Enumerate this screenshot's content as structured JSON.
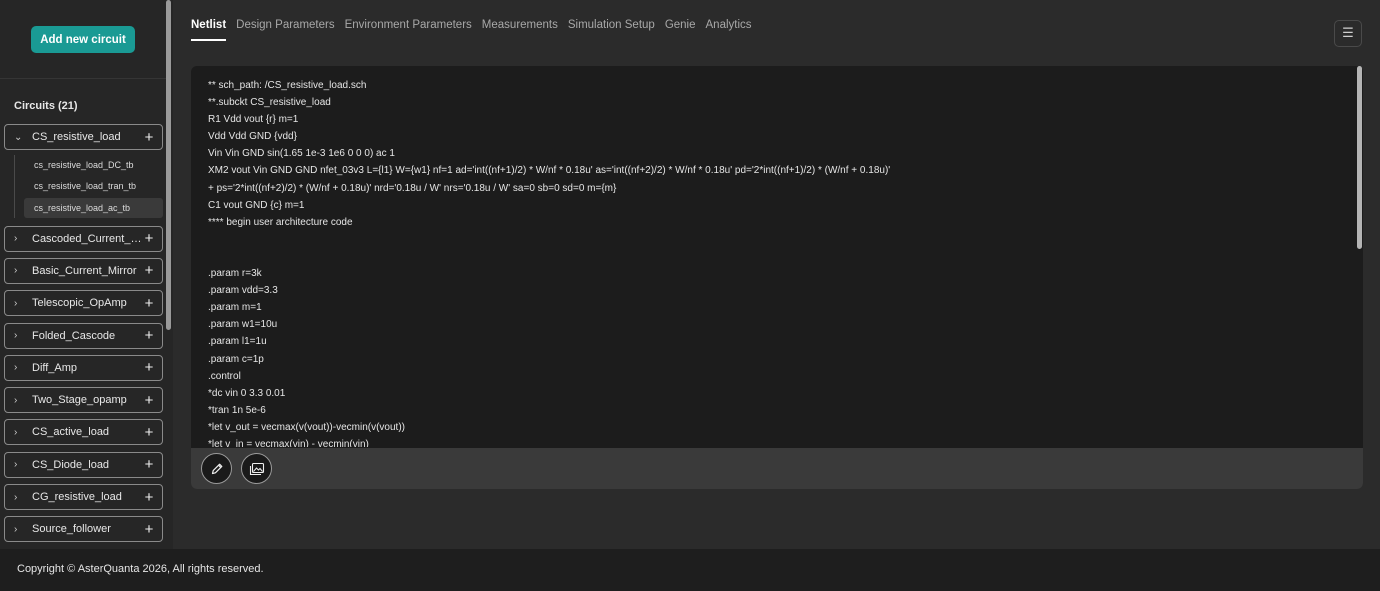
{
  "sidebar": {
    "add_button": "Add new circuit",
    "circuits_title": "Circuits (21)",
    "circuits": [
      {
        "name": "CS_resistive_load",
        "expanded": true,
        "children": [
          "cs_resistive_load_DC_tb",
          "cs_resistive_load_tran_tb",
          "cs_resistive_load_ac_tb"
        ],
        "active_child": 2
      },
      {
        "name": "Cascoded_Current_Mirror",
        "expanded": false
      },
      {
        "name": "Basic_Current_Mirror",
        "expanded": false
      },
      {
        "name": "Telescopic_OpAmp",
        "expanded": false
      },
      {
        "name": "Folded_Cascode",
        "expanded": false
      },
      {
        "name": "Diff_Amp",
        "expanded": false
      },
      {
        "name": "Two_Stage_opamp",
        "expanded": false
      },
      {
        "name": "CS_active_load",
        "expanded": false
      },
      {
        "name": "CS_Diode_load",
        "expanded": false
      },
      {
        "name": "CG_resistive_load",
        "expanded": false
      },
      {
        "name": "Source_follower",
        "expanded": false
      }
    ]
  },
  "tabs": [
    {
      "label": "Netlist",
      "active": true
    },
    {
      "label": "Design Parameters",
      "active": false
    },
    {
      "label": "Environment Parameters",
      "active": false
    },
    {
      "label": "Measurements",
      "active": false
    },
    {
      "label": "Simulation Setup",
      "active": false
    },
    {
      "label": "Genie",
      "active": false
    },
    {
      "label": "Analytics",
      "active": false
    }
  ],
  "menu_icon": "menu-icon",
  "editor": {
    "lines": [
      "** sch_path: /CS_resistive_load.sch",
      "**.subckt CS_resistive_load",
      "R1 Vdd vout {r} m=1",
      "Vdd Vdd GND {vdd}",
      "Vin Vin GND sin(1.65 1e-3 1e6 0 0 0) ac 1",
      "XM2 vout Vin GND GND nfet_03v3 L={l1} W={w1} nf=1 ad='int((nf+1)/2) * W/nf * 0.18u' as='int((nf+2)/2) * W/nf * 0.18u' pd='2*int((nf+1)/2) * (W/nf + 0.18u)'",
      "+ ps='2*int((nf+2)/2) * (W/nf + 0.18u)' nrd='0.18u / W' nrs='0.18u / W' sa=0 sb=0 sd=0 m={m}",
      "C1 vout GND {c} m=1",
      "**** begin user architecture code",
      "",
      "",
      ".param r=3k",
      ".param vdd=3.3",
      ".param m=1",
      ".param w1=10u",
      ".param l1=1u",
      ".param c=1p",
      ".control",
      "*dc vin 0 3.3 0.01",
      "*tran 1n 5e-6",
      "*let v_out = vecmax(v(vout))-vecmin(v(vout))",
      "*let v_in = vecmax(vin) - vecmin(vin)"
    ],
    "toolbar_icons": [
      "pencil-icon",
      "image-icon"
    ]
  },
  "footer": {
    "copyright": "Copyright © AsterQuanta 2026, All rights reserved."
  },
  "colors": {
    "accent": "#1a9a94",
    "background": "#2b2b2b",
    "editor_bg": "#1c1c1c"
  }
}
